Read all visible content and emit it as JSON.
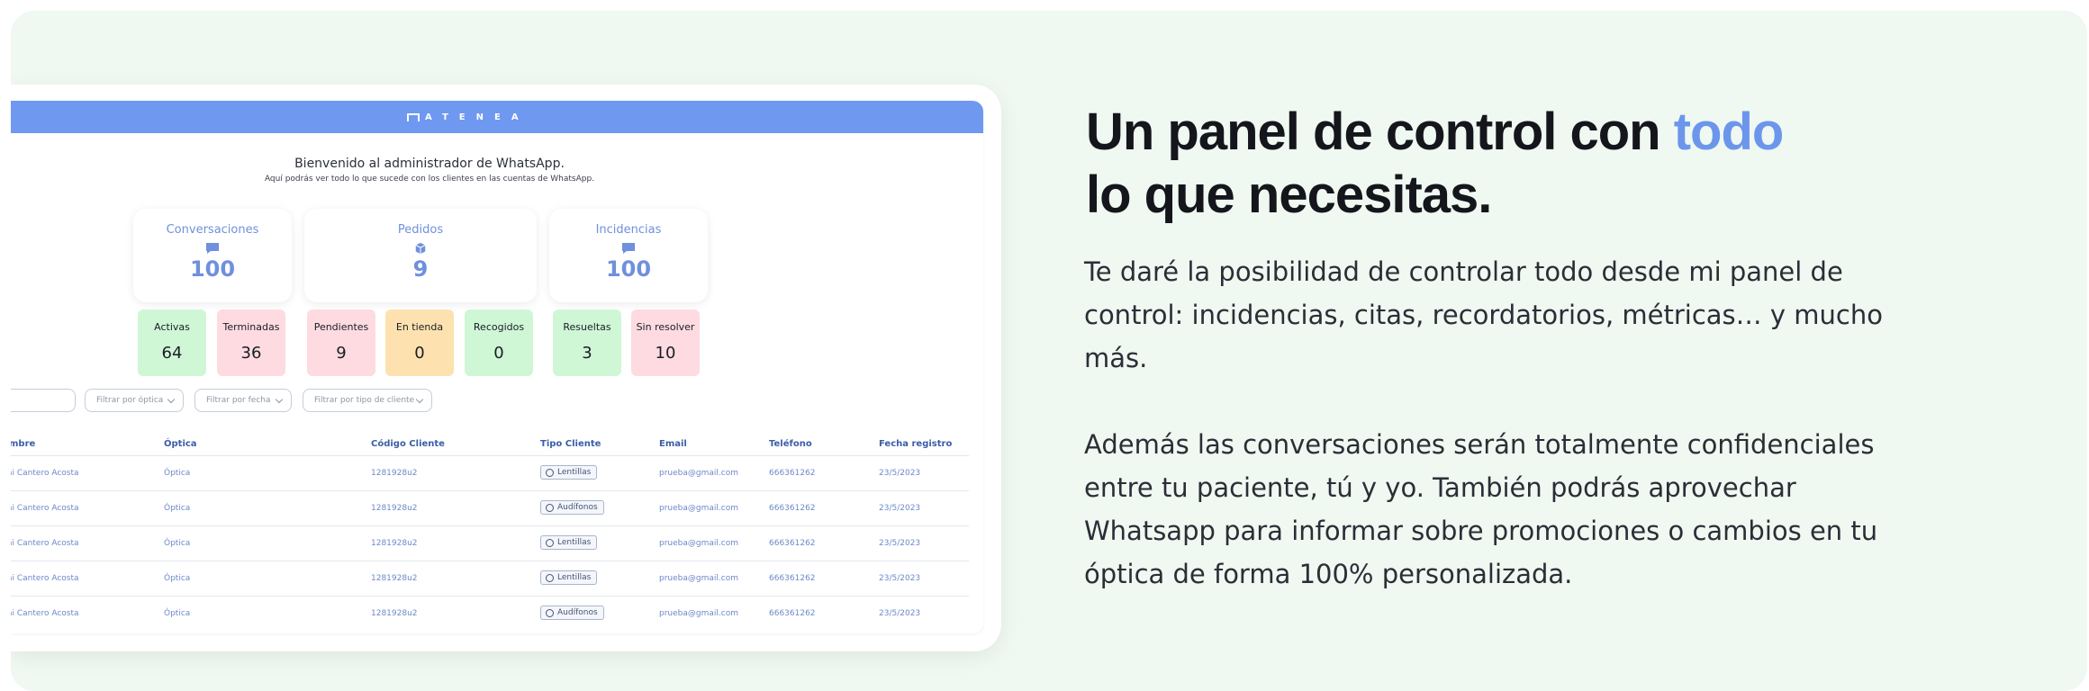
{
  "screenshot": {
    "logo_text": "ATENEA",
    "welcome_title": "Bienvenido al administrador de WhatsApp.",
    "welcome_subtitle": "Aquí podrás ver todo lo que sucede con los clientes en las cuentas de WhatsApp.",
    "stat_cards": [
      {
        "title": "Conversaciones",
        "icon": "chat-bubble-icon",
        "value": "100"
      },
      {
        "title": "Pedidos",
        "icon": "package-icon",
        "value": "9"
      },
      {
        "title": "Incidencias",
        "icon": "chat-bubble-icon",
        "value": "100"
      }
    ],
    "pills": [
      {
        "label": "Activas",
        "value": "64",
        "color": "#cff7d6"
      },
      {
        "label": "Terminadas",
        "value": "36",
        "color": "#fddbe1"
      },
      {
        "label": "Pendientes",
        "value": "9",
        "color": "#fddbe1"
      },
      {
        "label": "En tienda",
        "value": "0",
        "color": "#fde2b0"
      },
      {
        "label": "Recogidos",
        "value": "0",
        "color": "#cff7d6"
      },
      {
        "label": "Resueltas",
        "value": "3",
        "color": "#cff7d6"
      },
      {
        "label": "Sin resolver",
        "value": "10",
        "color": "#fddbe1"
      }
    ],
    "filters": [
      "Filtrar por óptica",
      "Filtrar por fecha",
      "Filtrar por tipo de cliente"
    ],
    "table": {
      "headers": [
        "mbre",
        "Óptica",
        "Código Cliente",
        "Tipo Cliente",
        "Email",
        "Teléfono",
        "Fecha registro"
      ],
      "rows": [
        [
          "ai Cantero Acosta",
          "Óptica",
          "1281928u2",
          "Lentillas",
          "prueba@gmail.com",
          "666361262",
          "23/5/2023"
        ],
        [
          "ai Cantero Acosta",
          "Óptica",
          "1281928u2",
          "Audífonos",
          "prueba@gmail.com",
          "666361262",
          "23/5/2023"
        ],
        [
          "ai Cantero Acosta",
          "Óptica",
          "1281928u2",
          "Lentillas",
          "prueba@gmail.com",
          "666361262",
          "23/5/2023"
        ],
        [
          "ai Cantero Acosta",
          "Óptica",
          "1281928u2",
          "Lentillas",
          "prueba@gmail.com",
          "666361262",
          "23/5/2023"
        ],
        [
          "ai Cantero Acosta",
          "Óptica",
          "1281928u2",
          "Audífonos",
          "prueba@gmail.com",
          "666361262",
          "23/5/2023"
        ]
      ]
    }
  },
  "headline": {
    "part1": "Un panel de control con ",
    "accent": "todo",
    "part2": "lo que necesitas."
  },
  "paragraphs": {
    "p1": "Te daré la posibilidad de controlar todo desde mi panel de control: incidencias, citas, recordatorios, métricas… y mucho más.",
    "p2": "Además las conversaciones serán totalmente confidenciales entre tu paciente, tú y yo. También podrás aprovechar Whatsapp para informar sobre promociones o cambios en tu óptica de forma 100% personalizada."
  },
  "colors": {
    "accent": "#6c96ec",
    "section_bg": "#eff8f1",
    "appbar": "#6f98f1"
  }
}
